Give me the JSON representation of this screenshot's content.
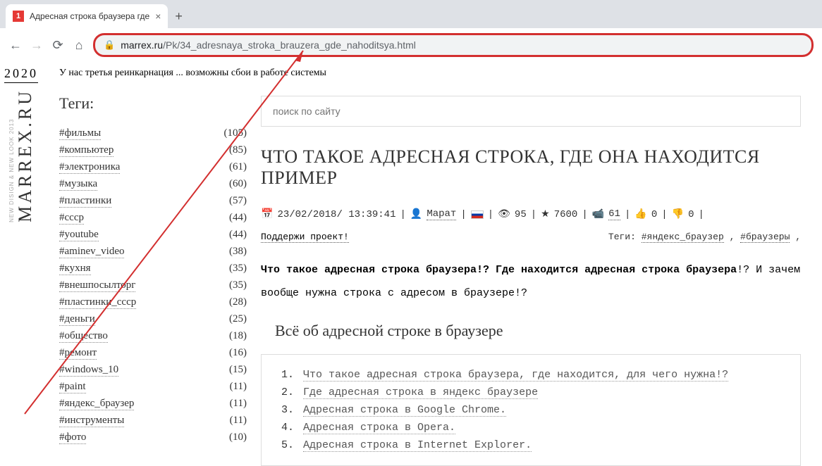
{
  "browser": {
    "tab_title": "Адресная строка браузера где",
    "url_domain": "marrex.ru",
    "url_path": "/Pk/34_adresnaya_stroka_brauzera_gde_nahoditsya.html"
  },
  "logo": {
    "year": "2020",
    "name": "MARREX.RU",
    "tagline": "NEW DISIGN & NEW LOOK 2013"
  },
  "notice": "У нас третья реинкарнация ... возможны сбои в работе системы",
  "sidebar": {
    "title": "Теги:",
    "tags": [
      {
        "name": "#фильмы",
        "count": "(105)"
      },
      {
        "name": "#компьютер",
        "count": "(85)"
      },
      {
        "name": "#электроника",
        "count": "(61)"
      },
      {
        "name": "#музыка",
        "count": "(60)"
      },
      {
        "name": "#пластинки",
        "count": "(57)"
      },
      {
        "name": "#ссср",
        "count": "(44)"
      },
      {
        "name": "#youtube",
        "count": "(44)"
      },
      {
        "name": "#aminev_video",
        "count": "(38)"
      },
      {
        "name": "#кухня",
        "count": "(35)"
      },
      {
        "name": "#внешпосылторг",
        "count": "(35)"
      },
      {
        "name": "#пластинки_ссср",
        "count": "(28)"
      },
      {
        "name": "#деньги",
        "count": "(25)"
      },
      {
        "name": "#общество",
        "count": "(18)"
      },
      {
        "name": "#ремонт",
        "count": "(16)"
      },
      {
        "name": "#windows_10",
        "count": "(15)"
      },
      {
        "name": "#paint",
        "count": "(11)"
      },
      {
        "name": "#яндекс_браузер",
        "count": "(11)"
      },
      {
        "name": "#инструменты",
        "count": "(11)"
      },
      {
        "name": "#фото",
        "count": "(10)"
      }
    ]
  },
  "search": {
    "placeholder": "поиск по сайту"
  },
  "article": {
    "title": "ЧТО ТАКОЕ АДРЕСНАЯ СТРОКА, ГДЕ ОНА НАХОДИТСЯ ПРИМЕР",
    "date": "23/02/2018/ 13:39:41",
    "author": "Марат",
    "views": "95",
    "stars": "7600",
    "video": "61",
    "thumbs_up": "0",
    "thumbs_down": "0",
    "support": "Поддержи проект!",
    "tags_label": "Теги:",
    "tag1": "#яндекс_браузер",
    "tag2": "#браузеры",
    "lead_bold": "Что такое адресная строка браузера!? Где находится адресная строка браузера",
    "lead_rest": "!? И зачем вообще нужна строка с адресом в браузере!?",
    "section_title": "Всё об адресной строке в браузере",
    "toc": [
      "Что такое адресная строка браузера, где находится, для чего нужна!?",
      "Где адресная строка в яндекс браузере",
      "Адресная строка в Google Chrome.",
      "Адресная строка в Opera.",
      "Адресная строка в Internet Explorer."
    ]
  }
}
